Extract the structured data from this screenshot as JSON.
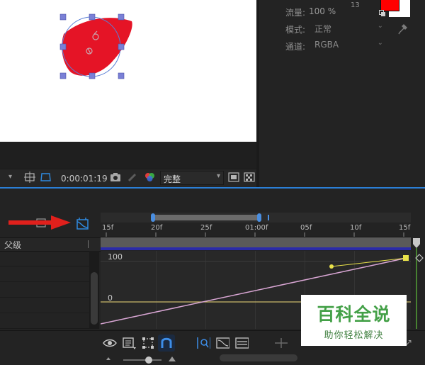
{
  "comp_viewer": {
    "timecode": "0:00:01:19",
    "resolution": "完整"
  },
  "paint_panel": {
    "flow_label": "流量:",
    "flow_value": "100 %",
    "brush_size": "13",
    "mode_label": "模式:",
    "mode_value": "正常",
    "channel_label": "通道:",
    "channel_value": "RGBA",
    "foreground_color": "#ff0000",
    "background_color": "#ffffff"
  },
  "timeline": {
    "parent_column": "父级",
    "ruler_ticks": [
      "15f",
      "20f",
      "25f",
      "01:00f",
      "05f",
      "10f",
      "15f"
    ],
    "graph_y_labels": [
      "100",
      "0"
    ]
  },
  "watermark": {
    "title": "百科全说",
    "subtitle": "助你轻松解决"
  },
  "annotation": {
    "arrow_color": "#e0201c"
  }
}
